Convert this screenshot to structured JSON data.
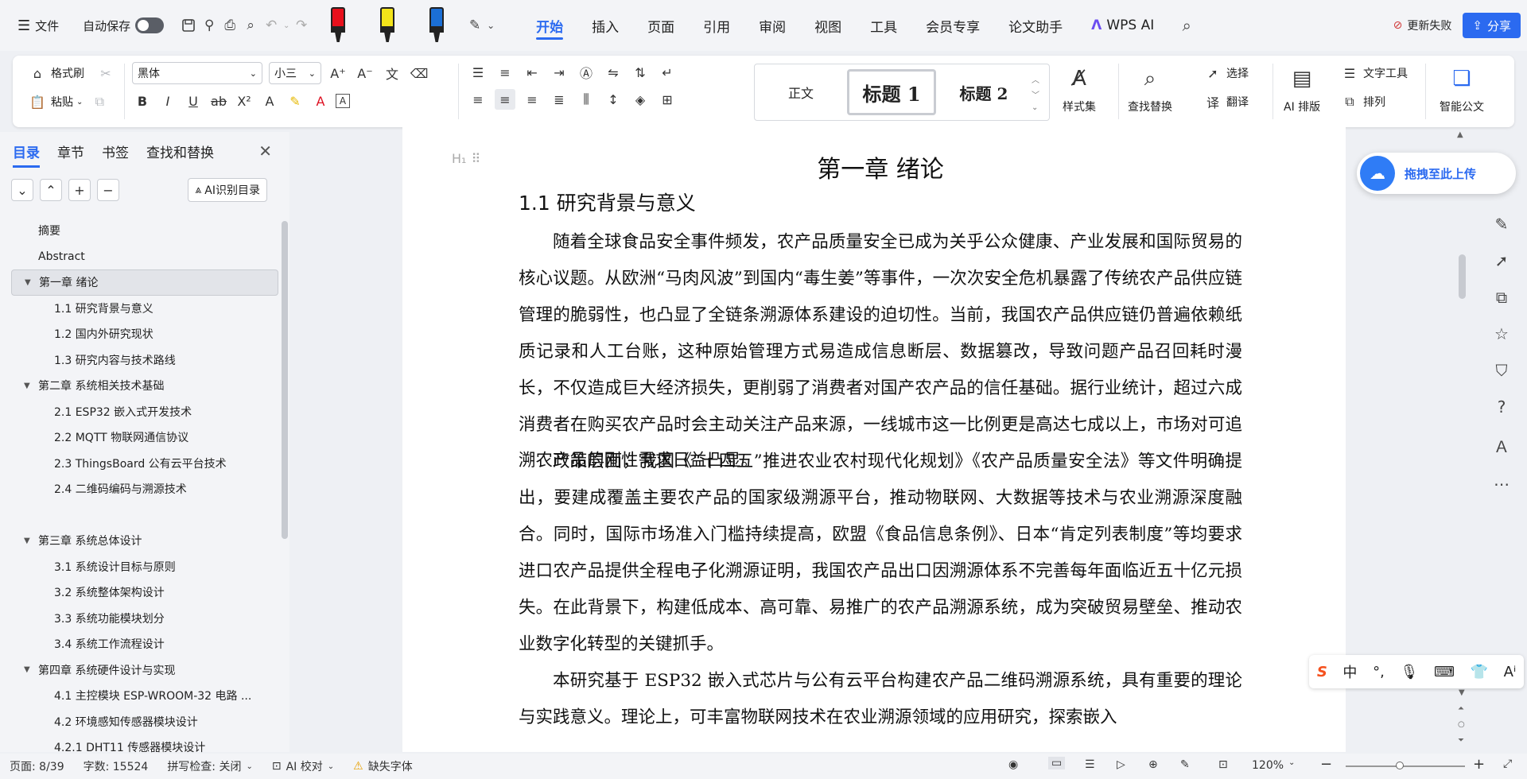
{
  "menubar": {
    "hamburger_label": "文件",
    "autosave_label": "自动保存",
    "tabs": [
      "开始",
      "插入",
      "页面",
      "引用",
      "审阅",
      "视图",
      "工具",
      "会员专享",
      "论文助手"
    ],
    "wps_ai": "WPS AI",
    "update_label": "更新失败",
    "share_label": "分享",
    "pen_colors": [
      "#e8101c",
      "#f3e31a",
      "#1b6fd6"
    ]
  },
  "ribbon": {
    "format_painter": "格式刷",
    "paste": "粘贴",
    "font_name": "黑体",
    "font_size": "小三",
    "style_normal": "正文",
    "style_h1": "标题 1",
    "style_h2": "标题 2",
    "style_set": "样式集",
    "find_replace": "查找替换",
    "select": "选择",
    "translate": "翻译",
    "ai_layout": "AI 排版",
    "text_tools": "文字工具",
    "arrange": "排列",
    "smart_doc": "智能公文"
  },
  "navpane": {
    "tabs": [
      "目录",
      "章节",
      "书签",
      "查找和替换"
    ],
    "ai_toc_label": "AI识别目录",
    "toc": [
      {
        "label": "摘要",
        "level": 0
      },
      {
        "label": "Abstract",
        "level": 0
      },
      {
        "label": "第一章  绪论",
        "level": 1,
        "selected": true
      },
      {
        "label": "1.1  研究背景与意义",
        "level": 2
      },
      {
        "label": "1.2  国内外研究现状",
        "level": 2
      },
      {
        "label": "1.3  研究内容与技术路线",
        "level": 2
      },
      {
        "label": "第二章  系统相关技术基础",
        "level": 1
      },
      {
        "label": "2.1 ESP32 嵌入式开发技术",
        "level": 2
      },
      {
        "label": "2.2 MQTT 物联网通信协议",
        "level": 2
      },
      {
        "label": "2.3 ThingsBoard 公有云平台技术",
        "level": 2
      },
      {
        "label": "2.4  二维码编码与溯源技术",
        "level": 2
      },
      {
        "label": "",
        "level": 2
      },
      {
        "label": "第三章  系统总体设计",
        "level": 1
      },
      {
        "label": "3.1  系统设计目标与原则",
        "level": 2
      },
      {
        "label": "3.2  系统整体架构设计",
        "level": 2
      },
      {
        "label": "3.3  系统功能模块划分",
        "level": 2
      },
      {
        "label": "3.4  系统工作流程设计",
        "level": 2
      },
      {
        "label": "第四章  系统硬件设计与实现",
        "level": 1
      },
      {
        "label": "4.1  主控模块  ESP-WROOM-32  电路 ...",
        "level": 2
      },
      {
        "label": "4.2  环境感知传感器模块设计",
        "level": 2
      },
      {
        "label": "4.2.1 DHT11  传感器模块设计",
        "level": 2
      }
    ]
  },
  "document": {
    "chapter_title": "第一章  绪论",
    "section_title": "1.1  研究背景与意义",
    "paragraphs": [
      "随着全球食品安全事件频发，农产品质量安全已成为关乎公众健康、产业发展和国际贸易的核心议题。从欧洲“马肉风波”到国内“毒生姜”等事件，一次次安全危机暴露了传统农产品供应链管理的脆弱性，也凸显了全链条溯源体系建设的迫切性。当前，我国农产品供应链仍普遍依赖纸质记录和人工台账，这种原始管理方式易造成信息断层、数据篡改，导致问题产品召回耗时漫长，不仅造成巨大经济损失，更削弱了消费者对国产农产品的信任基础。据行业统计，超过六成消费者在购买农产品时会主动关注产品来源，一线城市这一比例更是高达七成以上，市场对可追溯农产品的刚性需求日益凸显。",
      "政策层面，我国《“十四五”推进农业农村现代化规划》《农产品质量安全法》等文件明确提出，要建成覆盖主要农产品的国家级溯源平台，推动物联网、大数据等技术与农业溯源深度融合。同时，国际市场准入门槛持续提高，欧盟《食品信息条例》、日本“肯定列表制度”等均要求进口农产品提供全程电子化溯源证明，我国农产品出口因溯源体系不完善每年面临近五十亿元损失。在此背景下，构建低成本、高可靠、易推广的农产品溯源系统，成为突破贸易壁垒、推动农业数字化转型的关键抓手。",
      "本研究基于 ESP32 嵌入式芯片与公有云平台构建农产品二维码溯源系统，具有重要的理论与实践意义。理论上，可丰富物联网技术在农业溯源领域的应用研究，探索嵌入"
    ]
  },
  "sidebar": {
    "upload_label": "拖拽至此上传"
  },
  "ime": {
    "logo": "S",
    "lang": "中"
  },
  "statusbar": {
    "page": "页面: 8/39",
    "words": "字数: 15524",
    "spell": "拼写检查: 关闭",
    "ai_check": "AI 校对",
    "missing_font": "缺失字体",
    "zoom": "120%"
  }
}
